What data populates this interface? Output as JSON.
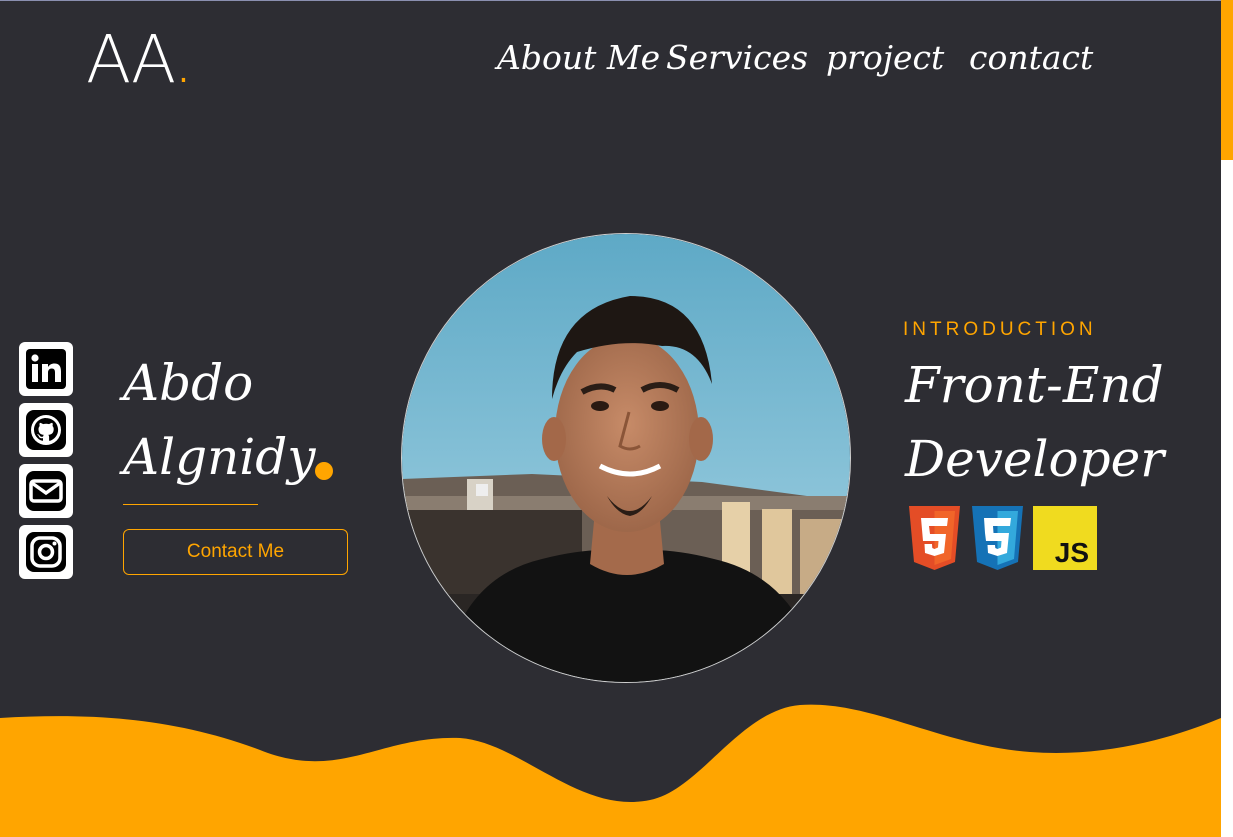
{
  "logo": {
    "text": "AA",
    "dot": "."
  },
  "nav": [
    {
      "label": "About Me"
    },
    {
      "label": "Services"
    },
    {
      "label": "project"
    },
    {
      "label": "contact"
    }
  ],
  "social": [
    "linkedin-icon",
    "github-icon",
    "mail-icon",
    "instagram-icon"
  ],
  "hero": {
    "first_name": "Abdo",
    "last_name": "Algnidy",
    "contact_button": "Contact Me",
    "intro_label": "INTRODUCTION",
    "title_line1": "Front-End",
    "title_line2": "Developer"
  },
  "tech": [
    {
      "name": "html5-icon",
      "label": "5"
    },
    {
      "name": "css3-icon",
      "label": "3"
    },
    {
      "name": "js-icon",
      "label": "JS"
    }
  ],
  "colors": {
    "background": "#2d2d33",
    "accent": "#ffa500",
    "text": "#ffffff"
  }
}
